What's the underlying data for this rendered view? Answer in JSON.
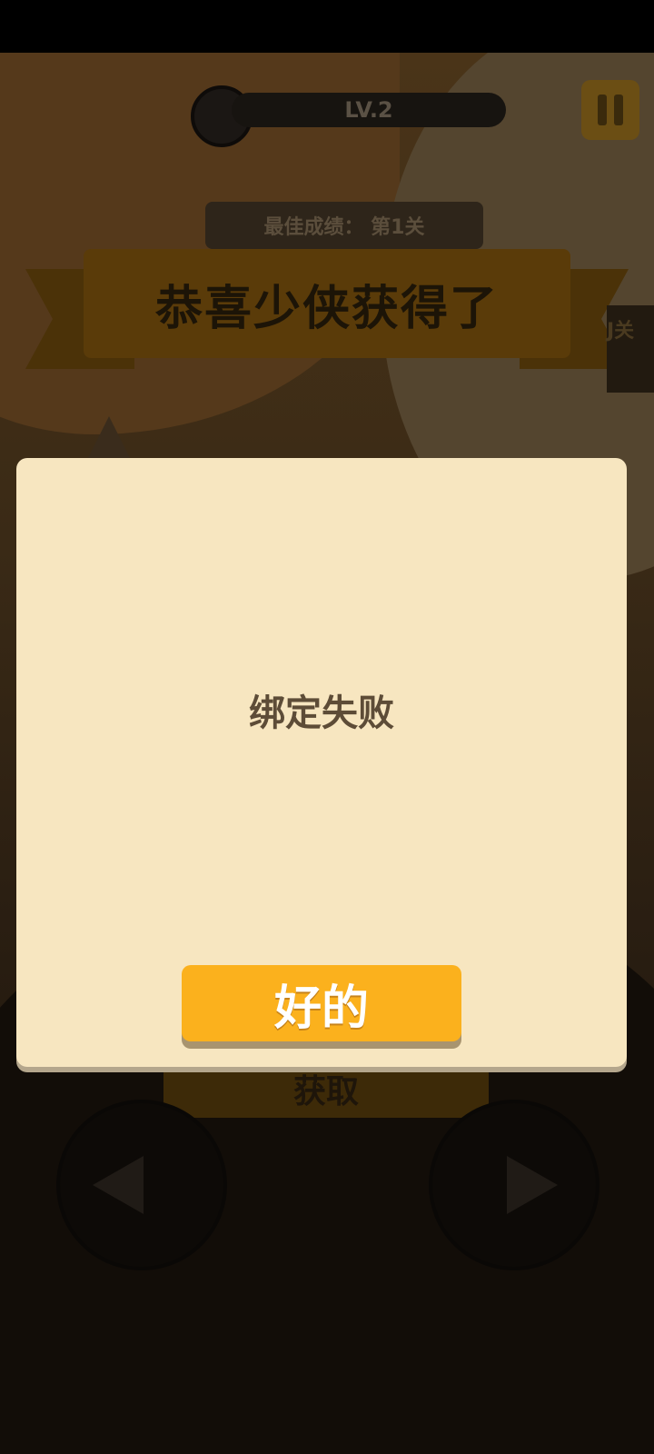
{
  "hud": {
    "level_label": "LV.2",
    "best_score_label": "最佳成绩：  第1关",
    "pause_icon": "pause-icon",
    "avatar_icon": "chick-avatar-icon"
  },
  "banner": {
    "title": "恭喜少侠获得了",
    "side_tab_text": "J关"
  },
  "background_button": {
    "label": "获取"
  },
  "dialog": {
    "message": "绑定失败",
    "ok_label": "好的"
  },
  "colors": {
    "dialog_bg": "#f7e6c0",
    "button_orange": "#fbb11d",
    "message_text": "#5d4c37"
  }
}
